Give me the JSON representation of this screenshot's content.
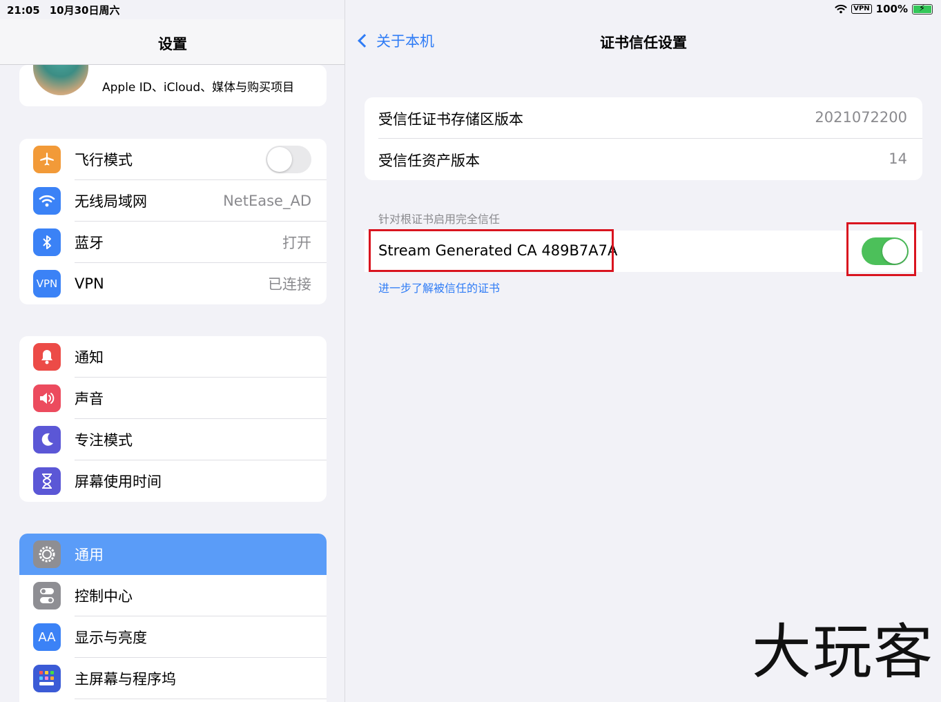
{
  "status_bar": {
    "time": "21:05",
    "date": "10月30日周六",
    "vpn": "VPN",
    "battery": "100%"
  },
  "left": {
    "title": "设置",
    "apple_id_subtitle": "Apple ID、iCloud、媒体与购买项目",
    "group1": [
      {
        "label": "飞行模式",
        "icon": "airplane-icon",
        "color": "#f29a38",
        "toggle": false
      },
      {
        "label": "无线局域网",
        "icon": "wifi-icon",
        "color": "#3b82f6",
        "value": "NetEase_AD"
      },
      {
        "label": "蓝牙",
        "icon": "bluetooth-icon",
        "color": "#3b82f6",
        "value": "打开"
      },
      {
        "label": "VPN",
        "icon": "vpn-icon",
        "color": "#3b82f6",
        "value": "已连接",
        "badge": "VPN"
      }
    ],
    "group2": [
      {
        "label": "通知",
        "icon": "bell-icon",
        "color": "#ec4b47"
      },
      {
        "label": "声音",
        "icon": "speaker-icon",
        "color": "#ec4b5e"
      },
      {
        "label": "专注模式",
        "icon": "moon-icon",
        "color": "#5b57d6"
      },
      {
        "label": "屏幕使用时间",
        "icon": "hourglass-icon",
        "color": "#5b57d6"
      }
    ],
    "group3": [
      {
        "label": "通用",
        "icon": "gear-icon",
        "color": "#8e8e93",
        "selected": true
      },
      {
        "label": "控制中心",
        "icon": "switches-icon",
        "color": "#8e8e93"
      },
      {
        "label": "显示与亮度",
        "icon": "text-size-icon",
        "color": "#3b82f6",
        "badge": "AA"
      },
      {
        "label": "主屏幕与程序坞",
        "icon": "home-grid-icon",
        "color": "#3b5bd6"
      }
    ]
  },
  "right": {
    "back_label": "关于本机",
    "title": "证书信任设置",
    "info": [
      {
        "label": "受信任证书存储区版本",
        "value": "2021072200"
      },
      {
        "label": "受信任资产版本",
        "value": "14"
      }
    ],
    "section_header": "针对根证书启用完全信任",
    "certificate": {
      "name": "Stream Generated CA 489B7A7A",
      "enabled": true
    },
    "learn_more": "进一步了解被信任的证书"
  },
  "watermark": "大玩客"
}
